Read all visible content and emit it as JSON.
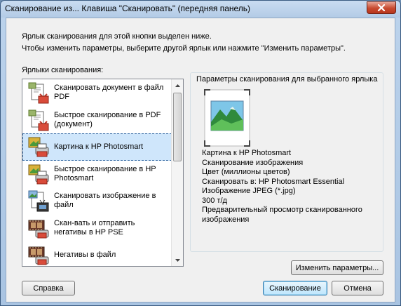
{
  "window": {
    "title": "Сканирование из... Клавиша \"Сканировать\" (передняя панель)"
  },
  "intro": {
    "line1": "Ярлык сканирования для этой кнопки выделен ниже.",
    "line2": "Чтобы изменить параметры, выберите другой ярлык или нажмите \"Изменить параметры\"."
  },
  "shortcuts": {
    "label": "Ярлыки сканирования:",
    "items": [
      {
        "line1": "Сканировать документ в файл",
        "line2": "PDF",
        "icon": "pdf-file-icon"
      },
      {
        "line1": "Быстрое сканирование в PDF",
        "line2": "(документ)",
        "icon": "pdf-file-icon"
      },
      {
        "line1": "Картина к HP Photosmart",
        "line2": "",
        "icon": "photo-print-icon",
        "selected": true
      },
      {
        "line1": "Быстрое сканирование в HP",
        "line2": "Photosmart",
        "icon": "photo-print-icon"
      },
      {
        "line1": "Сканировать изображение в",
        "line2": "файл",
        "icon": "image-file-icon"
      },
      {
        "line1": "Скан-вать и отправить",
        "line2": "негативы в HP PSE",
        "icon": "film-negative-icon"
      },
      {
        "line1": "Негативы в файл",
        "line2": "",
        "icon": "film-negative-icon"
      }
    ]
  },
  "params": {
    "title": "Параметры сканирования для выбранного ярлыка",
    "details": [
      "Картина к HP Photosmart",
      "Сканирование изображения",
      "Цвет (миллионы цветов)",
      "Сканировать в: HP Photosmart Essential",
      "Изображение JPEG (*.jpg)",
      "300 т/д",
      "Предварительный просмотр сканированного",
      "изображения"
    ]
  },
  "buttons": {
    "change": "Изменить параметры...",
    "help": "Справка",
    "scan": "Сканирование",
    "cancel": "Отмена"
  },
  "colors": {
    "selection": "#cfe6fb",
    "titlebar": "#b3cbe6",
    "close": "#c74a2f"
  }
}
